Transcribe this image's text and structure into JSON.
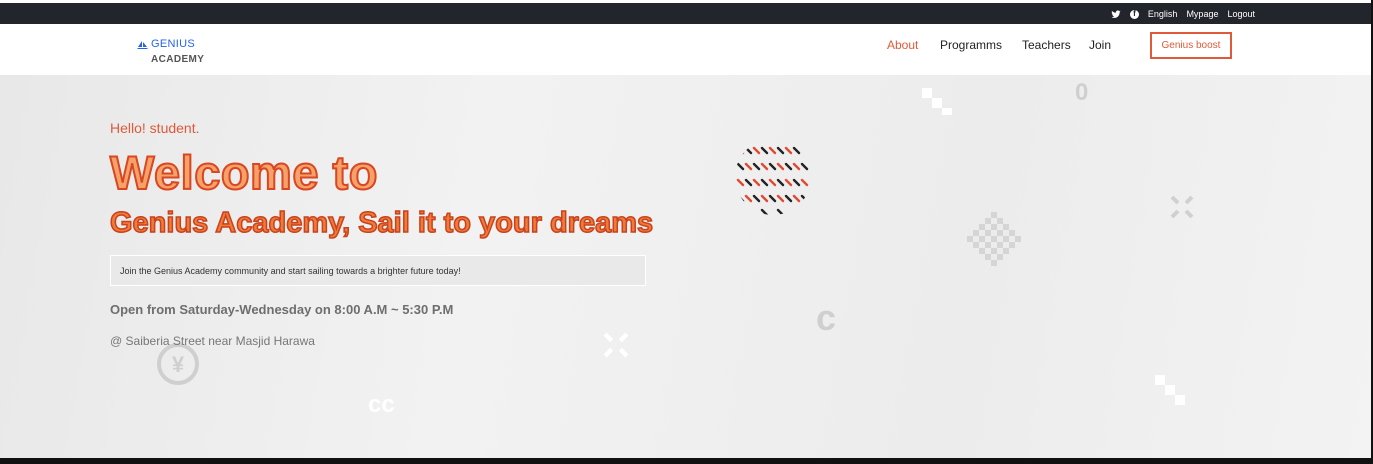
{
  "topbar": {
    "twitter_icon": "twitter-icon",
    "facebook_icon": "facebook-icon",
    "language": "English",
    "mypage": "Mypage",
    "logout": "Logout"
  },
  "brand": {
    "line1": "GENIUS",
    "line2": "ACADEMY",
    "icon": "sail-icon",
    "color": "#2563eb"
  },
  "nav": {
    "items": [
      {
        "label": "About",
        "active": true
      },
      {
        "label": "Programms",
        "active": false
      },
      {
        "label": "Teachers",
        "active": false
      },
      {
        "label": "Join",
        "active": false
      }
    ],
    "cta": "Genius boost",
    "accent": "#e05a3a"
  },
  "hero": {
    "greeting": "Hello! student.",
    "title": "Welcome to",
    "subtitle": "Genius Academy, Sail it to your dreams",
    "description": "Join the Genius Academy community and start sailing towards a brighter future today!",
    "hours": "Open from Saturday-Wednesday on 8:00 A.M ~ 5:30 P.M",
    "address": "@ Saiberia Street near Masjid Harawa",
    "decor_glyphs": {
      "zero": "0",
      "c": "c",
      "cc": "cc",
      "yen": "¥"
    }
  }
}
